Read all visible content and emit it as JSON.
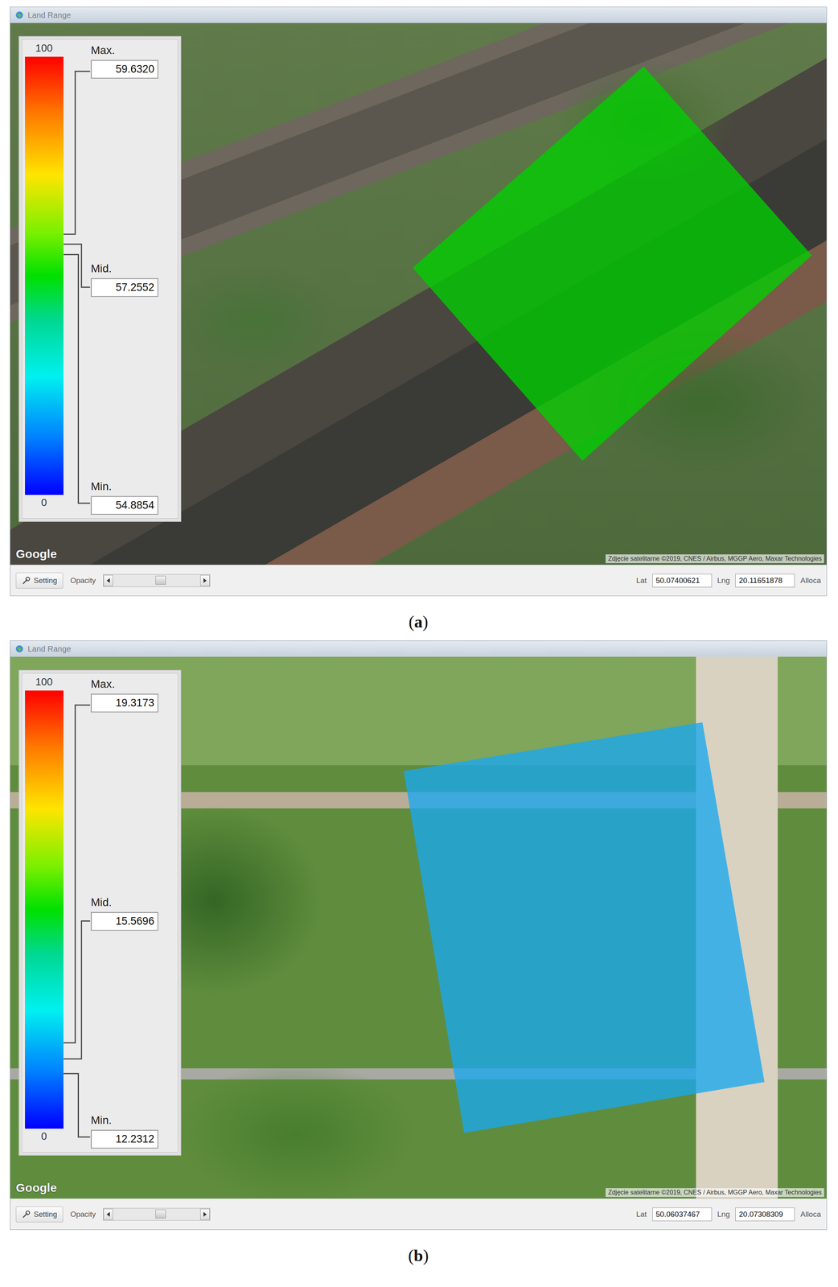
{
  "panels": [
    {
      "window": {
        "title": "Land Range"
      },
      "legend": {
        "scale_top": "100",
        "scale_bottom": "0",
        "markers": [
          {
            "label": "Max.",
            "value": "59.6320",
            "level": 0.596
          },
          {
            "label": "Mid.",
            "value": "57.2552",
            "level": 0.573
          },
          {
            "label": "Min.",
            "value": "54.8854",
            "level": 0.549
          }
        ]
      },
      "overlay": {
        "color": "#00d000"
      },
      "map": {
        "watermark": "Google",
        "attribution": "Zdjęcie satelitarne ©2019, CNES / Airbus, MGGP Aero, Maxar Technologies"
      },
      "toolbar": {
        "setting": "Setting",
        "opacity_label": "Opacity",
        "opacity": {
          "level": 0.55
        },
        "lat_label": "Lat",
        "lat": "50.07400621",
        "lng_label": "Lng",
        "lng": "20.11651878",
        "cut_label": "Alloca"
      },
      "caption": {
        "open": "(",
        "letter": "a",
        "close": ")"
      }
    },
    {
      "window": {
        "title": "Land Range"
      },
      "legend": {
        "scale_top": "100",
        "scale_bottom": "0",
        "markers": [
          {
            "label": "Max.",
            "value": "19.3173",
            "level": 0.193
          },
          {
            "label": "Mid.",
            "value": "15.5696",
            "level": 0.156
          },
          {
            "label": "Min.",
            "value": "12.2312",
            "level": 0.122
          }
        ]
      },
      "overlay": {
        "color": "#1aa8f0"
      },
      "map": {
        "watermark": "Google",
        "attribution": "Zdjęcie satelitarne ©2019, CNES / Airbus, MGGP Aero, Maxar Technologies"
      },
      "toolbar": {
        "setting": "Setting",
        "opacity_label": "Opacity",
        "opacity": {
          "level": 0.55
        },
        "lat_label": "Lat",
        "lat": "50.06037467",
        "lng_label": "Lng",
        "lng": "20.07308309",
        "cut_label": "Alloca"
      },
      "caption": {
        "open": "(",
        "letter": "b",
        "close": ")"
      }
    }
  ]
}
